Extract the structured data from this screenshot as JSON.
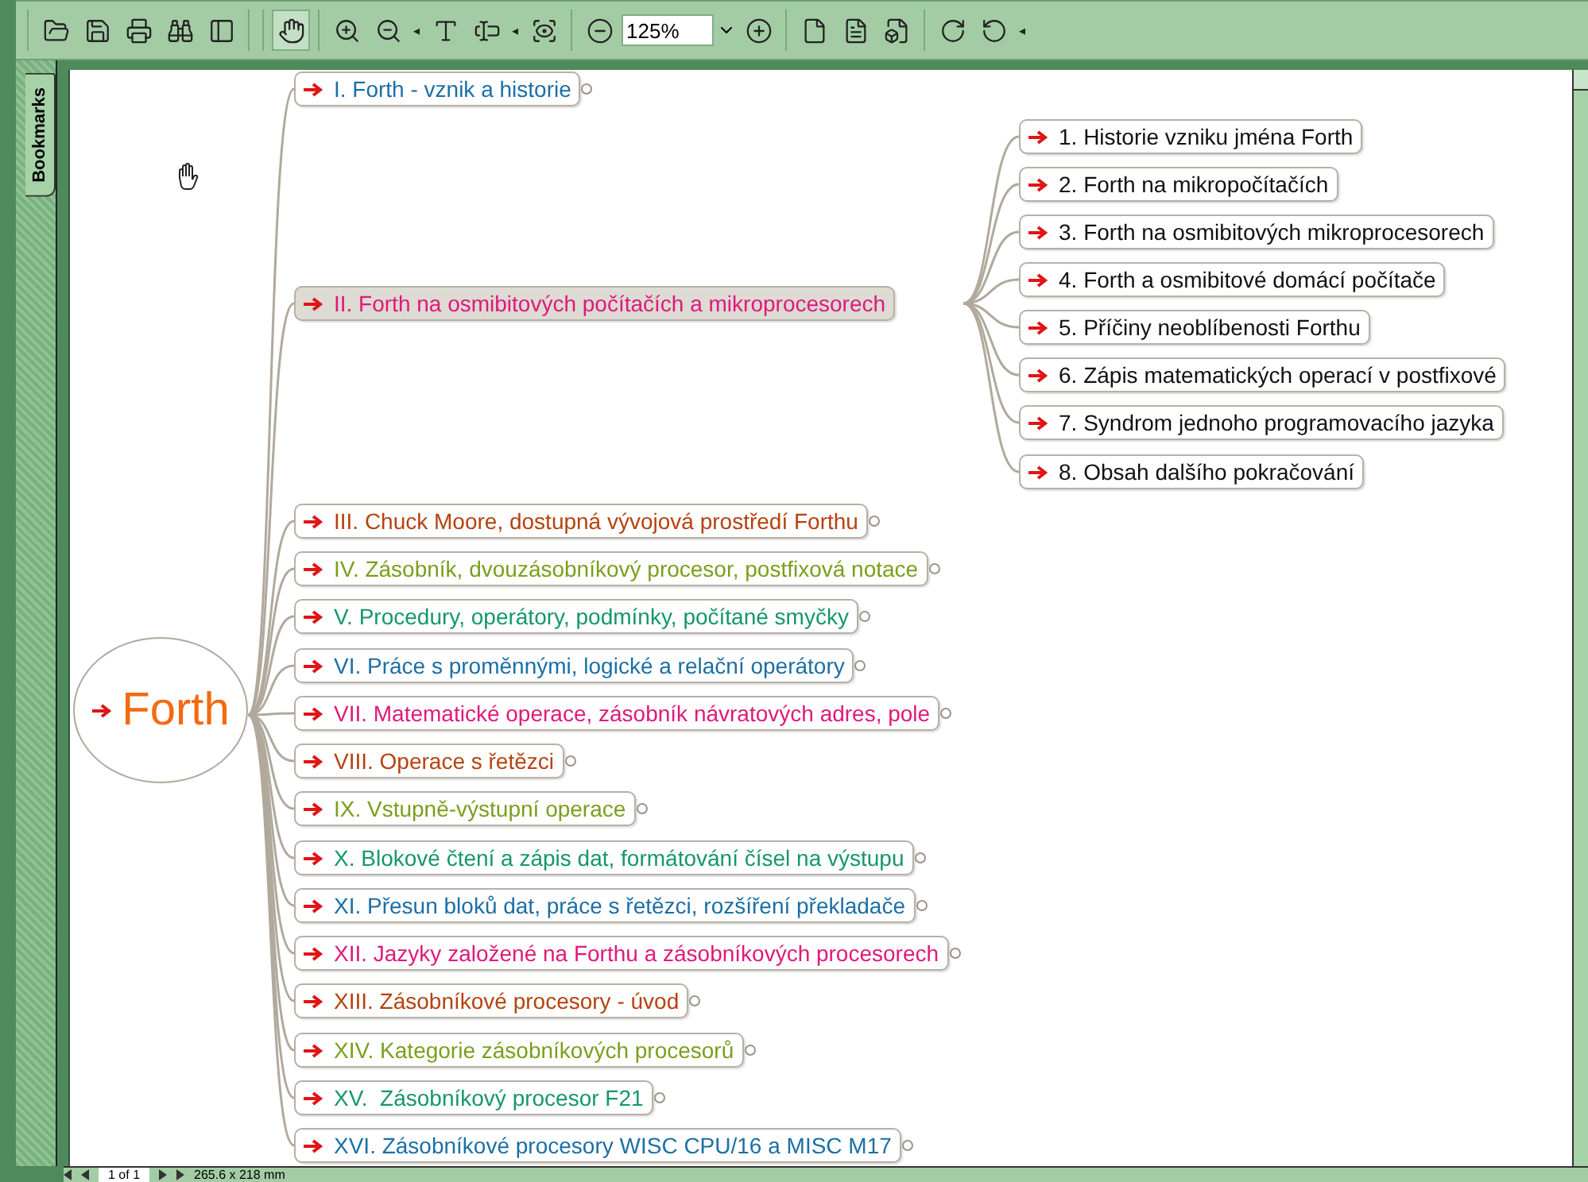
{
  "toolbar": {
    "buttons": [
      {
        "selected": false
      },
      {
        "selected": false
      },
      {
        "selected": false
      },
      {
        "selected": false
      },
      {
        "selected": false
      },
      {
        "selected": true
      },
      {
        "selected": false
      },
      {
        "selected": false
      },
      {
        "selected": false
      },
      {
        "selected": false
      },
      {
        "selected": false
      },
      {
        "selected": false
      },
      {
        "selected": false
      },
      {
        "selected": false
      },
      {
        "selected": false
      },
      {
        "selected": false
      },
      {
        "selected": false
      },
      {
        "selected": false
      }
    ],
    "zoom": "125%",
    "carets": [
      "◂",
      "◂",
      "◂"
    ]
  },
  "sidebar": {
    "tab": "Bookmarks"
  },
  "mindmap": {
    "root": "Forth",
    "nodes": [
      {
        "label": "I. Forth - vznik a historie",
        "color": "#1b6fa6",
        "selected": false,
        "collapsed": true
      },
      {
        "label": "II. Forth na osmibitových počítačích a mikroprocesorech",
        "color": "#e0197a",
        "selected": true,
        "collapsed": false,
        "children": [
          {
            "label": "1. Historie vzniku jména Forth"
          },
          {
            "label": "2. Forth na mikropočítačích"
          },
          {
            "label": "3. Forth na osmibitových mikroprocesorech"
          },
          {
            "label": "4. Forth a osmibitové domácí počítače"
          },
          {
            "label": "5. Příčiny neoblíbenosti Forthu"
          },
          {
            "label": "6. Zápis matematických operací v postfixové"
          },
          {
            "label": "7. Syndrom jednoho programovacího jazyka"
          },
          {
            "label": "8. Obsah dalšího pokračování"
          }
        ]
      },
      {
        "label": "III. Chuck Moore, dostupná vývojová prostředí Forthu",
        "color": "#b5420e",
        "selected": false,
        "collapsed": true
      },
      {
        "label": "IV. Zásobník, dvouzásobníkový procesor, postfixová notace",
        "color": "#7a9f1c",
        "selected": false,
        "collapsed": true
      },
      {
        "label": "V. Procedury, operátory, podmínky, počítané smyčky",
        "color": "#16976a",
        "selected": false,
        "collapsed": true
      },
      {
        "label": "VI. Práce s proměnnými, logické a relační operátory",
        "color": "#1b6fa6",
        "selected": false,
        "collapsed": true
      },
      {
        "label": "VII. Matematické operace, zásobník návratových adres, pole",
        "color": "#e0197a",
        "selected": false,
        "collapsed": true
      },
      {
        "label": "VIII. Operace s řetězci",
        "color": "#b5420e",
        "selected": false,
        "collapsed": true
      },
      {
        "label": "IX. Vstupně-výstupní operace",
        "color": "#7a9f1c",
        "selected": false,
        "collapsed": true
      },
      {
        "label": "X. Blokové čtení a zápis dat, formátování čísel na výstupu",
        "color": "#16976a",
        "selected": false,
        "collapsed": true
      },
      {
        "label": "XI. Přesun bloků dat, práce s řetězci, rozšíření překladače",
        "color": "#1b6fa6",
        "selected": false,
        "collapsed": true
      },
      {
        "label": "XII. Jazyky založené na Forthu a zásobníkových procesorech",
        "color": "#e0197a",
        "selected": false,
        "collapsed": true
      },
      {
        "label": "XIII. Zásobníkové procesory - úvod",
        "color": "#b5420e",
        "selected": false,
        "collapsed": true
      },
      {
        "label": "XIV. Kategorie zásobníkových procesorů",
        "color": "#7a9f1c",
        "selected": false,
        "collapsed": true
      },
      {
        "label": "XV.  Zásobníkový procesor F21",
        "color": "#16976a",
        "selected": false,
        "collapsed": true
      },
      {
        "label": "XVI. Zásobníkové procesory WISC CPU/16 a MISC M17",
        "color": "#1b6fa6",
        "selected": false,
        "collapsed": true
      }
    ]
  },
  "status_bar": {
    "page": "1 of 1",
    "size": "265.6 x 218 mm"
  }
}
